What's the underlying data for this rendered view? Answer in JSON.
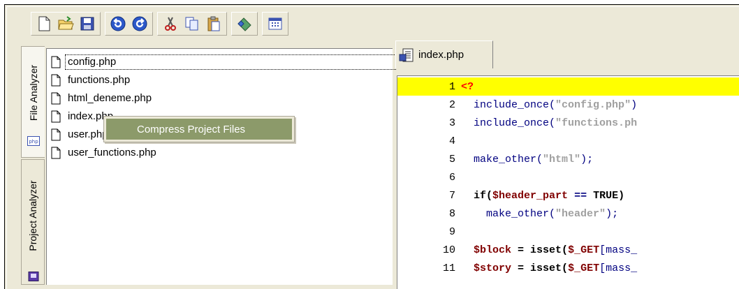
{
  "side_tabs": [
    {
      "label": "File Analyzer",
      "icon": "php-file-icon"
    },
    {
      "label": "Project Analyzer",
      "icon": "project-icon"
    }
  ],
  "toolbar": {
    "buttons": [
      "new-file-icon",
      "open-folder-icon",
      "save-icon",
      "undo-icon",
      "redo-icon",
      "cut-icon",
      "copy-icon",
      "paste-icon",
      "build-icon",
      "grid-view-icon"
    ]
  },
  "files": [
    {
      "name": "config.php"
    },
    {
      "name": "functions.php"
    },
    {
      "name": "html_deneme.php"
    },
    {
      "name": "index.php"
    },
    {
      "name": "user.php"
    },
    {
      "name": "user_functions.php"
    }
  ],
  "context_menu": {
    "item": "Compress Project Files"
  },
  "editor": {
    "tab_label": "index.php",
    "lines": [
      {
        "no": "1"
      },
      {
        "no": "2"
      },
      {
        "no": "3"
      },
      {
        "no": "4"
      },
      {
        "no": "5"
      },
      {
        "no": "6"
      },
      {
        "no": "7"
      },
      {
        "no": "8"
      },
      {
        "no": "9"
      },
      {
        "no": "10"
      },
      {
        "no": "11"
      }
    ],
    "tokens": {
      "l1_php_open": "<?",
      "l2_fn": "include_once(",
      "l2_str": "\"config.php\"",
      "l2_close": ")",
      "l3_fn": "include_once(",
      "l3_str": "\"functions.ph",
      "l5_fn": "make_other(",
      "l5_str": "\"html\"",
      "l5_close": ");",
      "l7_if": "if(",
      "l7_var": "$header_part",
      "l7_op": " == ",
      "l7_true": "TRUE)",
      "l8_fn": "make_other(",
      "l8_str": "\"header\"",
      "l8_close": ");",
      "l10_var": "$block",
      "l10_eq": " = ",
      "l10_isset": "isset(",
      "l10_get": "$_GET",
      "l10_rest": "[mass_",
      "l11_var": "$story",
      "l11_eq": " = ",
      "l11_isset": "isset(",
      "l11_get": "$_GET",
      "l11_rest": "[mass_"
    }
  }
}
